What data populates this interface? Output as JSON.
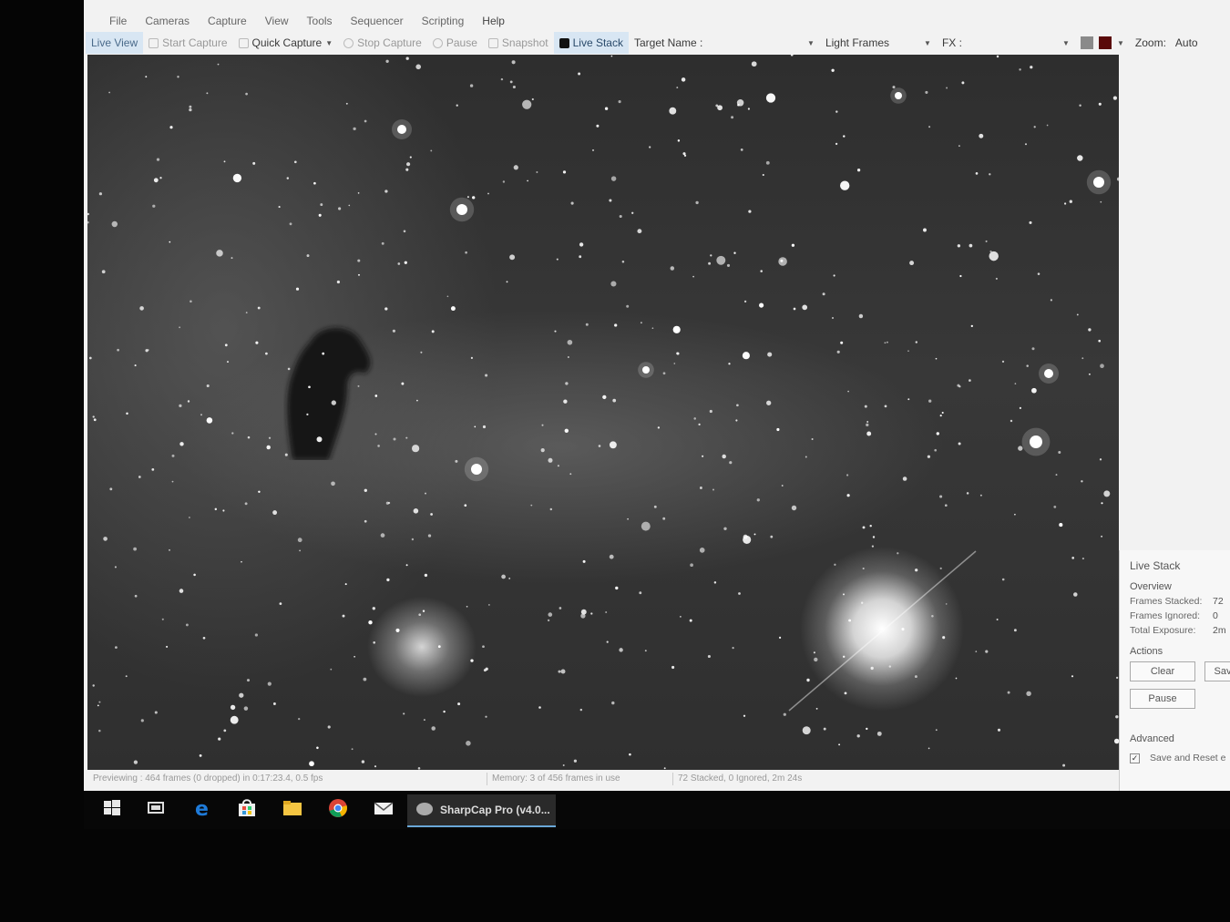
{
  "menu": [
    "File",
    "Cameras",
    "Capture",
    "View",
    "Tools",
    "Sequencer",
    "Scripting",
    "Help"
  ],
  "toolbar": {
    "live_view": "Live View",
    "start_capture": "Start Capture",
    "quick_capture": "Quick Capture",
    "stop_capture": "Stop Capture",
    "pause": "Pause",
    "snapshot": "Snapshot",
    "live_stack": "Live Stack",
    "target_name": "Target Name :",
    "frame_type": "Light Frames",
    "fx": "FX :",
    "zoom_label": "Zoom:",
    "zoom_value": "Auto",
    "swatch_gray": "#8a8a8a",
    "swatch_red": "#5a0a0a"
  },
  "live_stack_panel": {
    "title": "Live Stack",
    "overview": "Overview",
    "frames_stacked_label": "Frames Stacked:",
    "frames_stacked": "72",
    "frames_ignored_label": "Frames Ignored:",
    "frames_ignored": "0",
    "total_exposure_label": "Total Exposure:",
    "total_exposure": "2m",
    "actions": "Actions",
    "clear": "Clear",
    "save": "Sav",
    "pause": "Pause",
    "advanced": "Advanced",
    "save_and_reset": "Save and Reset e",
    "save_and_reset_checked": true
  },
  "status_bar": {
    "previewing": "Previewing : 464 frames (0 dropped) in 0:17:23.4, 0.5 fps",
    "memory": "Memory: 3 of 456 frames in use",
    "stack_status": "72 Stacked, 0 Ignored, 2m 24s"
  },
  "taskbar": {
    "active_app": "SharpCap Pro (v4.0..."
  }
}
